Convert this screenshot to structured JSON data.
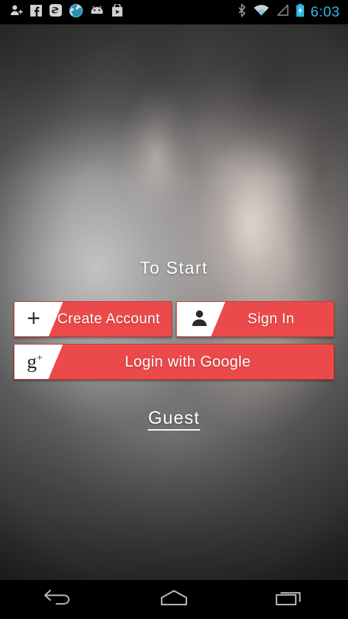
{
  "status_bar": {
    "left_icons": [
      {
        "name": "add-contact-icon",
        "label": "Add contact notification"
      },
      {
        "name": "facebook-icon",
        "label": "Facebook"
      },
      {
        "name": "app-notification-icon",
        "label": "App notification"
      },
      {
        "name": "browser-icon",
        "label": "Browser"
      },
      {
        "name": "android-icon",
        "label": "Android system"
      },
      {
        "name": "play-store-icon",
        "label": "Play Store"
      }
    ],
    "right_icons": [
      {
        "name": "bluetooth-icon",
        "label": "Bluetooth"
      },
      {
        "name": "wifi-icon",
        "label": "Wi-Fi"
      },
      {
        "name": "signal-icon",
        "label": "Mobile signal"
      },
      {
        "name": "battery-charging-icon",
        "label": "Battery charging"
      }
    ],
    "clock": "6:03",
    "clock_color": "#33B5E5"
  },
  "main": {
    "heading": "To Start",
    "accent_color": "#EC4A4A",
    "buttons": [
      {
        "id": "create-account",
        "label": "Create Account",
        "icon": "plus-icon",
        "icon_glyph": "+"
      },
      {
        "id": "sign-in",
        "label": "Sign In",
        "icon": "person-icon",
        "icon_glyph": ""
      },
      {
        "id": "login-google",
        "label": "Login with Google",
        "icon": "google-plus-icon",
        "icon_glyph": "g+"
      }
    ],
    "guest_link": "Guest"
  },
  "nav_bar": {
    "buttons": [
      {
        "name": "back-button",
        "label": "Back"
      },
      {
        "name": "home-button",
        "label": "Home"
      },
      {
        "name": "recents-button",
        "label": "Recent apps"
      }
    ]
  }
}
